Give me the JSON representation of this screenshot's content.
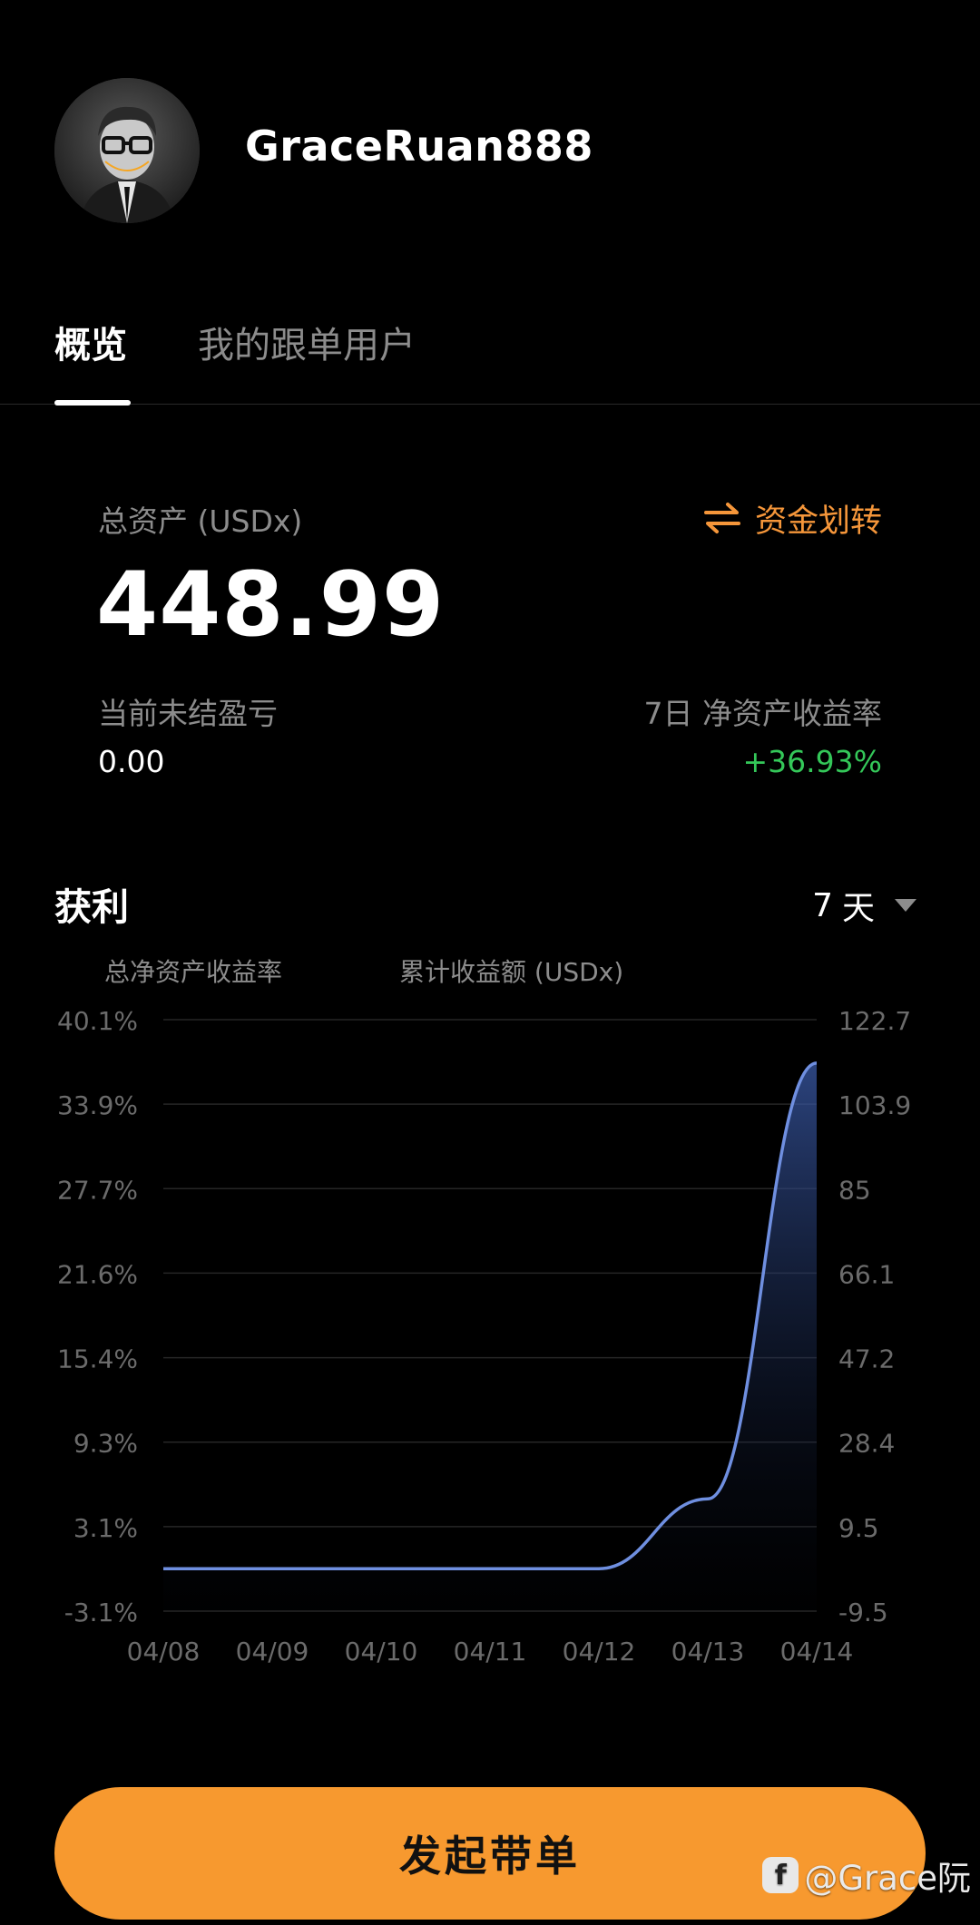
{
  "profile": {
    "username": "GraceRuan888"
  },
  "tabs": [
    {
      "label": "概览",
      "active": true
    },
    {
      "label": "我的跟单用户",
      "active": false
    }
  ],
  "overview": {
    "total_assets_label": "总资产 (USDx)",
    "total_assets_value": "448.99",
    "transfer_label": "资金划转",
    "unrealized_pnl_label": "当前未结盈亏",
    "unrealized_pnl_value": "0.00",
    "roi_label": "7日 净资产收益率",
    "roi_value": "+36.93%"
  },
  "profit": {
    "title": "获利",
    "period_value": "7",
    "period_unit": "天",
    "legend_left": "总净资产收益率",
    "legend_right": "累计收益额 (USDx)"
  },
  "chart_data": {
    "type": "area",
    "x": [
      "04/08",
      "04/09",
      "04/10",
      "04/11",
      "04/12",
      "04/13",
      "04/14"
    ],
    "series": [
      {
        "values": [
          0,
          0,
          0,
          0,
          0,
          5.1,
          36.93
        ]
      }
    ],
    "y_left_ticks": [
      "40.1%",
      "33.9%",
      "27.7%",
      "21.6%",
      "15.4%",
      "9.3%",
      "3.1%",
      "-3.1%"
    ],
    "y_right_ticks": [
      "122.7",
      "103.9",
      "85",
      "66.1",
      "47.2",
      "28.4",
      "9.5",
      "-9.5"
    ],
    "ylim": [
      -3.1,
      40.1
    ],
    "grid": true,
    "line_color": "#6f8fe0"
  },
  "cta": {
    "label": "发起带单"
  },
  "watermark": {
    "text": "@Grace阮"
  },
  "colors": {
    "accent": "#f7992f",
    "positive": "#34c759",
    "muted": "#8c8c8c"
  }
}
